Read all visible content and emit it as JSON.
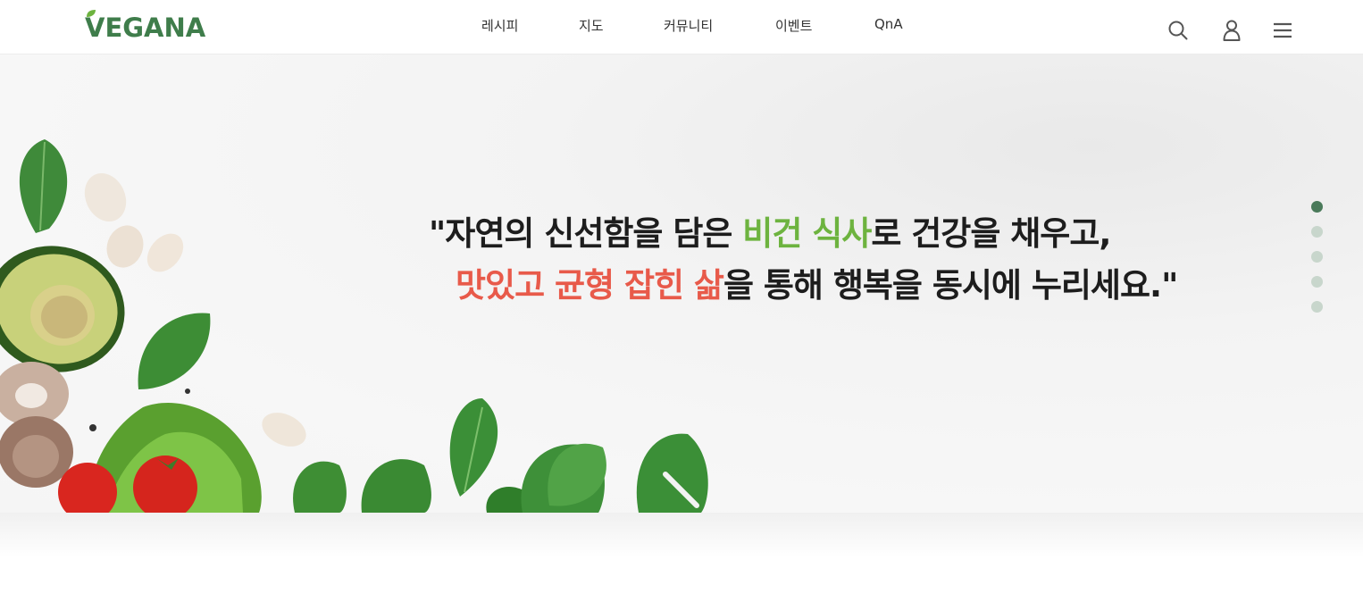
{
  "brand": {
    "logo_text": "VEGANA",
    "primary_color": "#3f7d4b"
  },
  "nav": {
    "recipe": "레시피",
    "map": "지도",
    "community": "커뮤니티",
    "event": "이벤트",
    "qna": "QnA"
  },
  "header_icons": [
    "search-icon",
    "user-icon",
    "menu-icon"
  ],
  "hero": {
    "line1_prefix": "\"자연의 신선함을 담은 ",
    "line1_highlight": "비건 식사",
    "line1_suffix": "로 건강을 채우고,",
    "line2_highlight": "맛있고 균형 잡힌 삶",
    "line2_suffix": "을 통해 행복을 동시에 누리세요.\"",
    "highlight_green": "#6db33f",
    "highlight_red": "#e85a4a"
  },
  "slider": {
    "total": 5,
    "active_index": 0
  }
}
